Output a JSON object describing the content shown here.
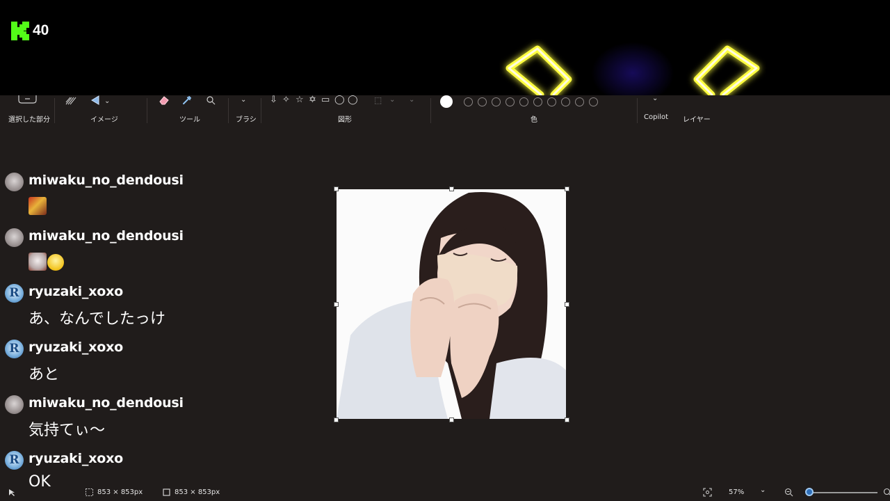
{
  "stream": {
    "viewer_count": "40",
    "brand_color": "#53fc18"
  },
  "ribbon": {
    "groups": [
      {
        "label": "選択した部分"
      },
      {
        "label": "イメージ"
      },
      {
        "label": "ツール"
      },
      {
        "label": "ブラシ"
      },
      {
        "label": "図形"
      },
      {
        "label": "色"
      },
      {
        "label": "Copilot"
      },
      {
        "label": "レイヤー"
      }
    ]
  },
  "chat": {
    "messages": [
      {
        "username": "miwaku_no_dendousi",
        "avatar": "cat-avatar",
        "text": "",
        "emotes": [
          "emote-portrait"
        ]
      },
      {
        "username": "miwaku_no_dendousi",
        "avatar": "cat-avatar",
        "text": "",
        "emotes": [
          "emote-cat",
          "emote-smile"
        ]
      },
      {
        "username": "ryuzaki_xoxo",
        "avatar": "r-avatar",
        "text": "あ、なんでしたっけ"
      },
      {
        "username": "ryuzaki_xoxo",
        "avatar": "r-avatar",
        "text": "あと"
      },
      {
        "username": "miwaku_no_dendousi",
        "avatar": "cat-avatar",
        "text": "気持てぃ〜"
      },
      {
        "username": "ryuzaki_xoxo",
        "avatar": "r-avatar",
        "text": "OK"
      }
    ]
  },
  "statusbar": {
    "selection_size": "853 × 853px",
    "canvas_size": "853 × 853px",
    "zoom": "57%",
    "zoom_fraction": 0.07
  }
}
